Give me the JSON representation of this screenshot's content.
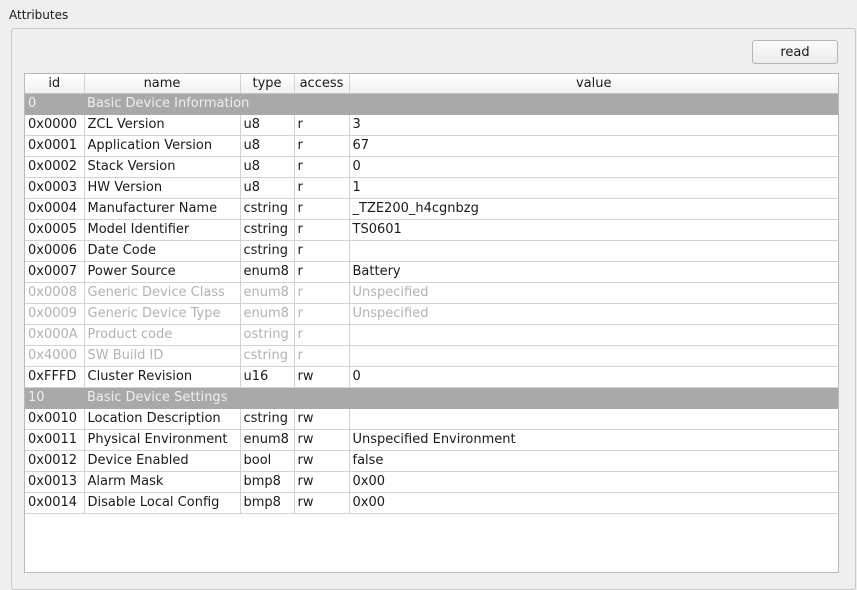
{
  "group": {
    "title": "Attributes"
  },
  "toolbar": {
    "read_label": "read"
  },
  "table": {
    "columns": [
      "id",
      "name",
      "type",
      "access",
      "value"
    ],
    "sections": [
      {
        "id": "0",
        "name": "Basic Device Information",
        "rows": [
          {
            "id": "0x0000",
            "name": "ZCL Version",
            "type": "u8",
            "access": "r",
            "value": "3",
            "enabled": true
          },
          {
            "id": "0x0001",
            "name": "Application Version",
            "type": "u8",
            "access": "r",
            "value": "67",
            "enabled": true
          },
          {
            "id": "0x0002",
            "name": "Stack Version",
            "type": "u8",
            "access": "r",
            "value": "0",
            "enabled": true
          },
          {
            "id": "0x0003",
            "name": "HW Version",
            "type": "u8",
            "access": "r",
            "value": "1",
            "enabled": true
          },
          {
            "id": "0x0004",
            "name": "Manufacturer Name",
            "type": "cstring",
            "access": "r",
            "value": "_TZE200_h4cgnbzg",
            "enabled": true
          },
          {
            "id": "0x0005",
            "name": "Model Identifier",
            "type": "cstring",
            "access": "r",
            "value": "TS0601",
            "enabled": true
          },
          {
            "id": "0x0006",
            "name": "Date Code",
            "type": "cstring",
            "access": "r",
            "value": "",
            "enabled": true
          },
          {
            "id": "0x0007",
            "name": "Power Source",
            "type": "enum8",
            "access": "r",
            "value": "Battery",
            "enabled": true
          },
          {
            "id": "0x0008",
            "name": "Generic Device Class",
            "type": "enum8",
            "access": "r",
            "value": "Unspecified",
            "enabled": false
          },
          {
            "id": "0x0009",
            "name": "Generic Device Type",
            "type": "enum8",
            "access": "r",
            "value": "Unspecified",
            "enabled": false
          },
          {
            "id": "0x000A",
            "name": "Product code",
            "type": "ostring",
            "access": "r",
            "value": "",
            "enabled": false
          },
          {
            "id": "0x4000",
            "name": "SW Build ID",
            "type": "cstring",
            "access": "r",
            "value": "",
            "enabled": false
          },
          {
            "id": "0xFFFD",
            "name": "Cluster Revision",
            "type": "u16",
            "access": "rw",
            "value": "0",
            "enabled": true
          }
        ]
      },
      {
        "id": "10",
        "name": "Basic Device Settings",
        "rows": [
          {
            "id": "0x0010",
            "name": "Location Description",
            "type": "cstring",
            "access": "rw",
            "value": "",
            "enabled": true
          },
          {
            "id": "0x0011",
            "name": "Physical Environment",
            "type": "enum8",
            "access": "rw",
            "value": "Unspecified Environment",
            "enabled": true
          },
          {
            "id": "0x0012",
            "name": "Device Enabled",
            "type": "bool",
            "access": "rw",
            "value": "false",
            "enabled": true
          },
          {
            "id": "0x0013",
            "name": "Alarm Mask",
            "type": "bmp8",
            "access": "rw",
            "value": "0x00",
            "enabled": true
          },
          {
            "id": "0x0014",
            "name": "Disable Local Config",
            "type": "bmp8",
            "access": "rw",
            "value": "0x00",
            "enabled": true
          }
        ]
      }
    ]
  }
}
